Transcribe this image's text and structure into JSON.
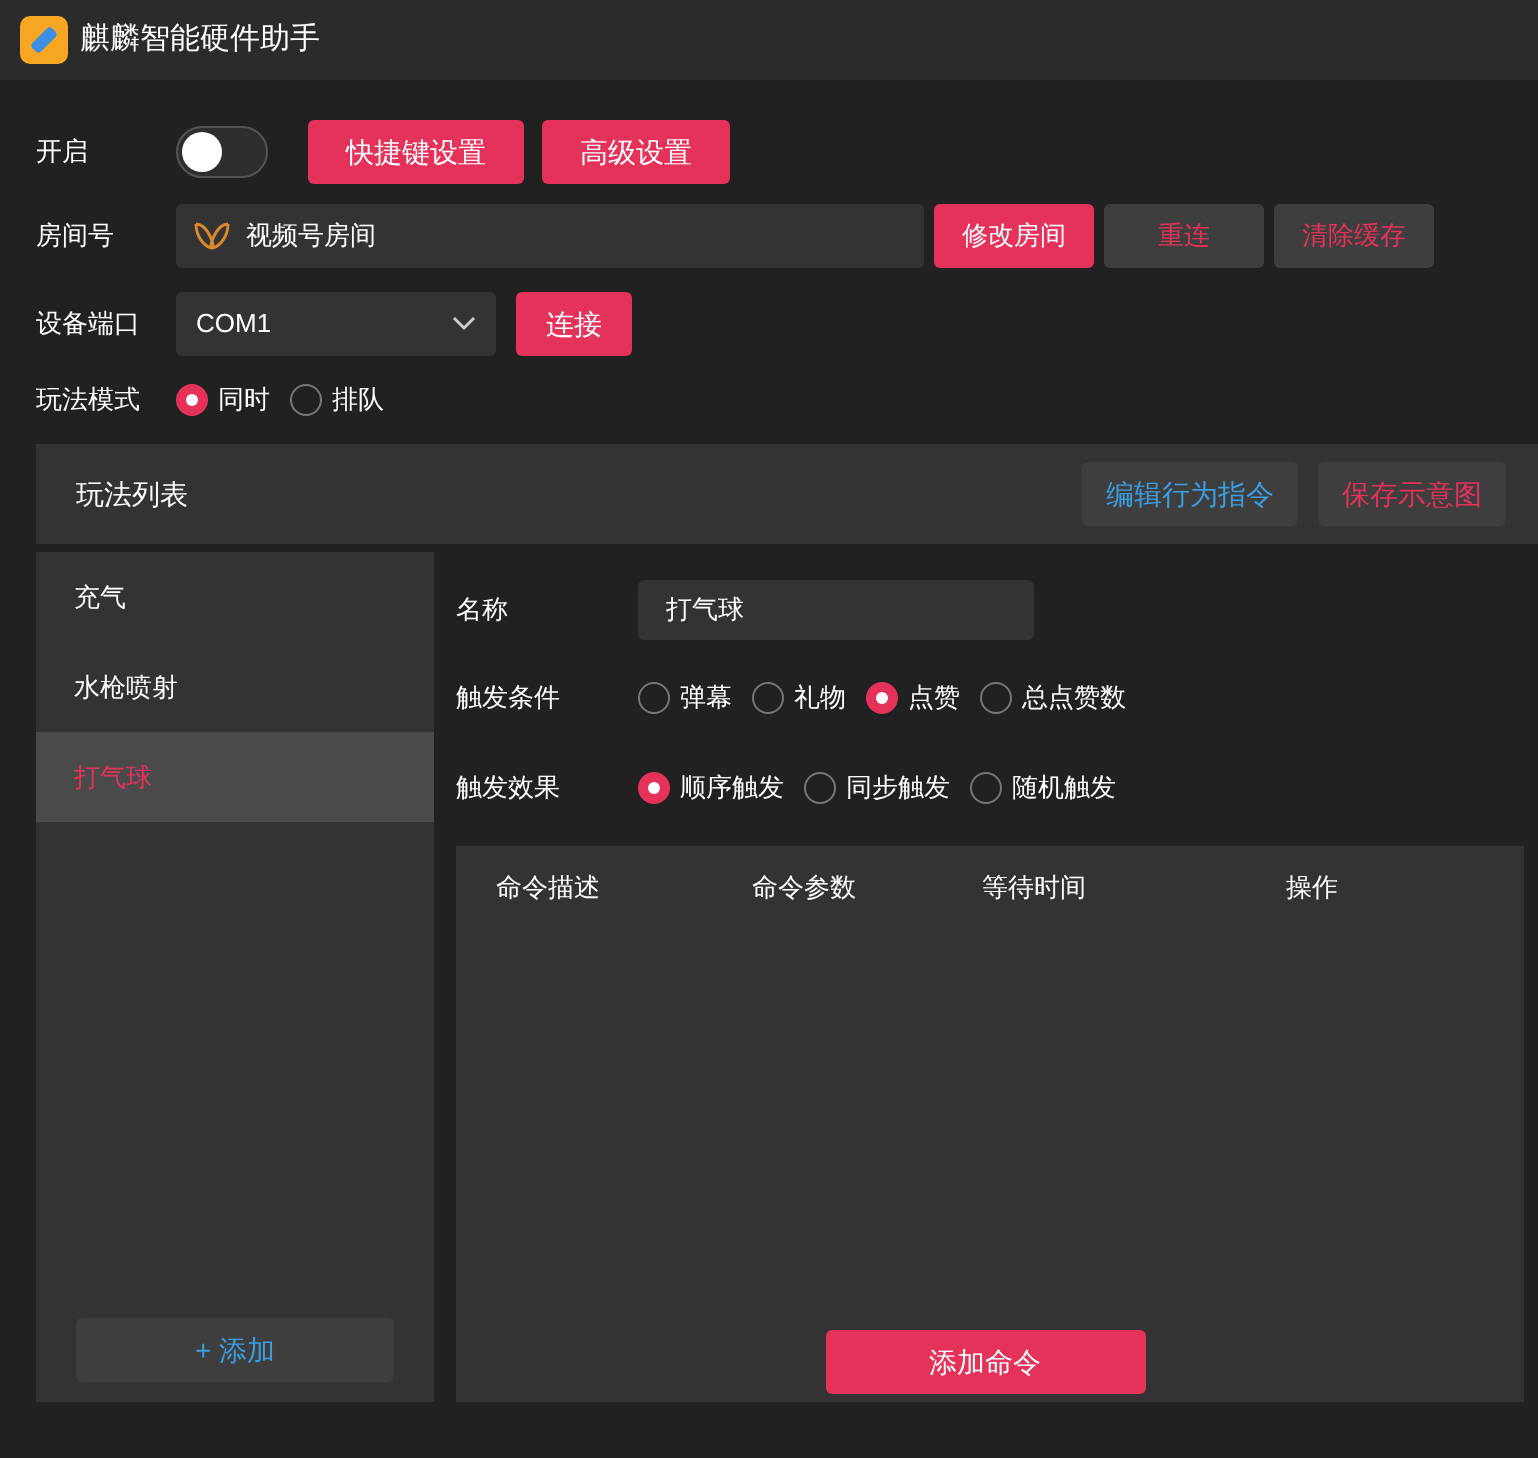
{
  "window": {
    "title": "麒麟智能硬件助手"
  },
  "enable": {
    "label": "开启",
    "on": false
  },
  "top_buttons": [
    "快捷键设置",
    "高级设置"
  ],
  "room": {
    "label": "房间号",
    "value": "视频号房间",
    "buttons": [
      {
        "label": "修改房间",
        "kind": "primary"
      },
      {
        "label": "重连",
        "kind": "secondary"
      },
      {
        "label": "清除缓存",
        "kind": "secondary"
      }
    ]
  },
  "port": {
    "label": "设备端口",
    "value": "COM1",
    "button": "连接"
  },
  "mode": {
    "label": "玩法模式",
    "options": [
      {
        "label": "同时",
        "selected": true
      },
      {
        "label": "排队",
        "selected": false
      }
    ]
  },
  "panel": {
    "title": "玩法列表",
    "buttons": [
      {
        "label": "编辑行为指令",
        "kind": "info"
      },
      {
        "label": "保存示意图",
        "kind": "danger"
      }
    ]
  },
  "play_list": [
    {
      "label": "充气",
      "selected": false
    },
    {
      "label": "水枪喷射",
      "selected": false
    },
    {
      "label": "打气球",
      "selected": true
    }
  ],
  "add_button": "+ 添加",
  "detail": {
    "name_label": "名称",
    "name_value": "打气球",
    "trigger_label": "触发条件",
    "triggers": [
      {
        "label": "弹幕",
        "selected": false
      },
      {
        "label": "礼物",
        "selected": false
      },
      {
        "label": "点赞",
        "selected": true
      },
      {
        "label": "总点赞数",
        "selected": false
      }
    ],
    "effect_label": "触发效果",
    "effects": [
      {
        "label": "顺序触发",
        "selected": true
      },
      {
        "label": "同步触发",
        "selected": false
      },
      {
        "label": "随机触发",
        "selected": false
      }
    ],
    "table": {
      "columns": [
        "命令描述",
        "命令参数",
        "等待时间",
        "操作"
      ]
    },
    "add_command": "添加命令"
  }
}
